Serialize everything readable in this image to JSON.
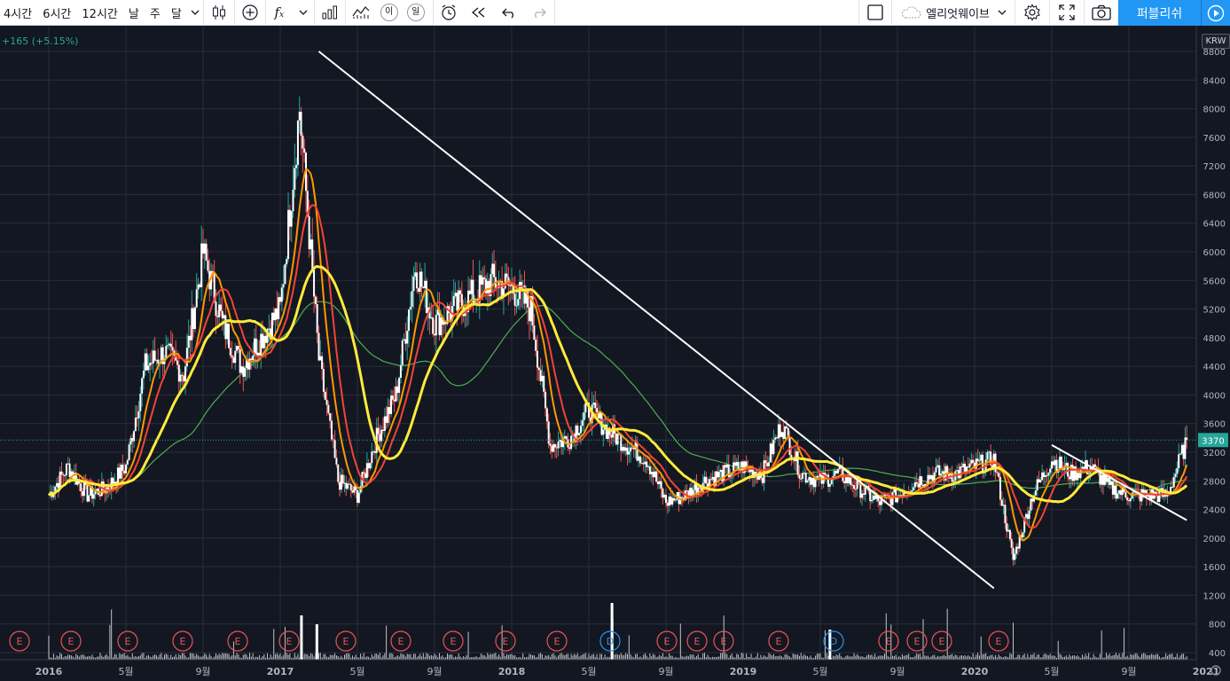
{
  "toolbar": {
    "intervals": [
      "4시간",
      "6시간",
      "12시간",
      "날",
      "주",
      "달"
    ],
    "active_interval": "4시간",
    "compare_icon_label": "이",
    "log_icon_label": "일",
    "layout_name": "엘리엇웨이브",
    "publish_label": "퍼블리쉬"
  },
  "legend": {
    "change": "+165 (+5.15%)"
  },
  "price_axis": {
    "currency": "KRW",
    "ticks": [
      "8800",
      "8400",
      "8000",
      "7600",
      "7200",
      "6800",
      "6400",
      "6000",
      "5600",
      "5200",
      "4800",
      "4400",
      "4000",
      "3600",
      "3200",
      "2800",
      "2400",
      "2000",
      "1600",
      "1200",
      "800",
      "400"
    ],
    "last_price": "3370"
  },
  "time_axis": {
    "labels": [
      "2016",
      "5월",
      "9월",
      "2017",
      "5월",
      "9월",
      "2018",
      "5월",
      "9월",
      "2019",
      "5월",
      "9월",
      "2020",
      "5월",
      "9월",
      "2021"
    ]
  },
  "event_markers": [
    "E",
    "E",
    "E",
    "E",
    "E",
    "E",
    "E",
    "E",
    "E",
    "E",
    "E",
    "D",
    "E",
    "E",
    "E",
    "E",
    "D",
    "E",
    "E",
    "E",
    "E"
  ],
  "colors": {
    "background": "#131722",
    "grid": "#2a2e39",
    "candle": "#ffffff",
    "ma_fast": "#ff9800",
    "ma_mid": "#f44336",
    "ma_slow": "#ffeb3b",
    "ma_long": "#4caf50",
    "trendline": "#ffffff",
    "last_price": "#26a69a",
    "publish": "#2196f3"
  },
  "chart_data": {
    "type": "line",
    "title": "",
    "y_unit": "KRW",
    "ylim": [
      400,
      8800
    ],
    "x": [
      "2016-01",
      "2016-02",
      "2016-03",
      "2016-04",
      "2016-05",
      "2016-06",
      "2016-07",
      "2016-08",
      "2016-09",
      "2016-10",
      "2016-11",
      "2016-12",
      "2017-01",
      "2017-02",
      "2017-03",
      "2017-04",
      "2017-05",
      "2017-06",
      "2017-07",
      "2017-08",
      "2017-09",
      "2017-10",
      "2017-11",
      "2017-12",
      "2018-01",
      "2018-02",
      "2018-03",
      "2018-04",
      "2018-05",
      "2018-06",
      "2018-07",
      "2018-08",
      "2018-09",
      "2018-10",
      "2018-11",
      "2018-12",
      "2019-01",
      "2019-02",
      "2019-03",
      "2019-04",
      "2019-05",
      "2019-06",
      "2019-07",
      "2019-08",
      "2019-09",
      "2019-10",
      "2019-11",
      "2019-12",
      "2020-01",
      "2020-02",
      "2020-03",
      "2020-04",
      "2020-05",
      "2020-06",
      "2020-07",
      "2020-08",
      "2020-09",
      "2020-10",
      "2020-11",
      "2020-12"
    ],
    "series": [
      {
        "values": [
          2600,
          3000,
          2600,
          2700,
          3000,
          4400,
          4600,
          4300,
          6000,
          5000,
          4400,
          4800,
          5200,
          8000,
          4500,
          2800,
          2600,
          3400,
          4000,
          5800,
          5000,
          5200,
          5400,
          5600,
          5500,
          5200,
          3300,
          3400,
          3800,
          3500,
          3300,
          3100,
          2500,
          2600,
          2800,
          2900,
          3000,
          2900,
          3600,
          2900,
          2800,
          2900,
          2700,
          2500,
          2600,
          2800,
          2900,
          2900,
          3000,
          3100,
          1700,
          2600,
          3100,
          2900,
          3000,
          2700,
          2600,
          2600,
          2600,
          3370
        ]
      }
    ],
    "volume_max_label": "",
    "trendlines": [
      {
        "from": [
          "2017-03",
          8800
        ],
        "to": [
          "2020-02",
          1300
        ]
      },
      {
        "from": [
          "2020-05",
          3300
        ],
        "to": [
          "2020-12",
          2250
        ]
      }
    ]
  }
}
